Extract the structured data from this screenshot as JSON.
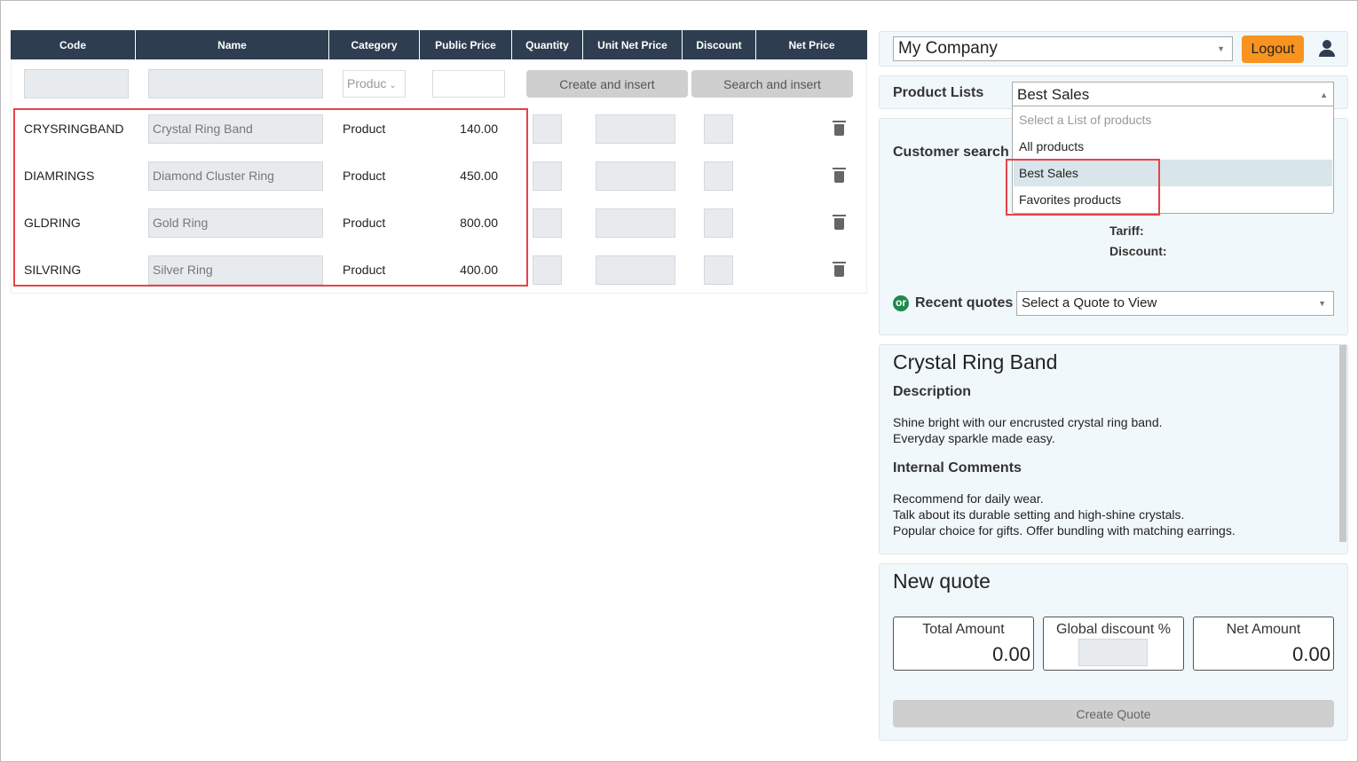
{
  "table": {
    "headers": [
      "Code",
      "Name",
      "Category",
      "Public Price",
      "Quantity",
      "Unit Net Price",
      "Discount",
      "Net Price"
    ],
    "new_row": {
      "category_placeholder": "Produc",
      "create_label": "Create and insert",
      "search_label": "Search and insert"
    },
    "rows": [
      {
        "code": "CRYSRINGBAND",
        "name": "Crystal Ring Band",
        "category": "Product",
        "price": "140.00"
      },
      {
        "code": "DIAMRINGS",
        "name": "Diamond Cluster Ring",
        "category": "Product",
        "price": "450.00"
      },
      {
        "code": "GLDRING",
        "name": "Gold Ring",
        "category": "Product",
        "price": "800.00"
      },
      {
        "code": "SILVRING",
        "name": "Silver Ring",
        "category": "Product",
        "price": "400.00"
      }
    ]
  },
  "header": {
    "company": "My Company",
    "logout": "Logout",
    "accent": "#f7931e"
  },
  "product_lists": {
    "label": "Product Lists",
    "selected": "Best Sales",
    "options": [
      "Select a List of products",
      "All products",
      "Best Sales",
      "Favorites products"
    ]
  },
  "customer": {
    "label": "Customer search",
    "tariff": "Tariff:",
    "discount": "Discount:",
    "or": "or",
    "recent_label": "Recent quotes",
    "recent_placeholder": "Select a Quote to View"
  },
  "product": {
    "title": "Crystal Ring Band",
    "desc_label": "Description",
    "desc": [
      "Shine bright with our encrusted crystal ring band.",
      "Everyday sparkle made easy."
    ],
    "comments_label": "Internal Comments",
    "comments": [
      "Recommend for daily wear.",
      "Talk about its durable setting and high-shine crystals.",
      "Popular choice for gifts. Offer bundling with matching earrings."
    ]
  },
  "quote": {
    "title": "New quote",
    "total_label": "Total Amount",
    "total": "0.00",
    "global_label": "Global discount %",
    "net_label": "Net Amount",
    "net": "0.00",
    "create": "Create Quote"
  }
}
